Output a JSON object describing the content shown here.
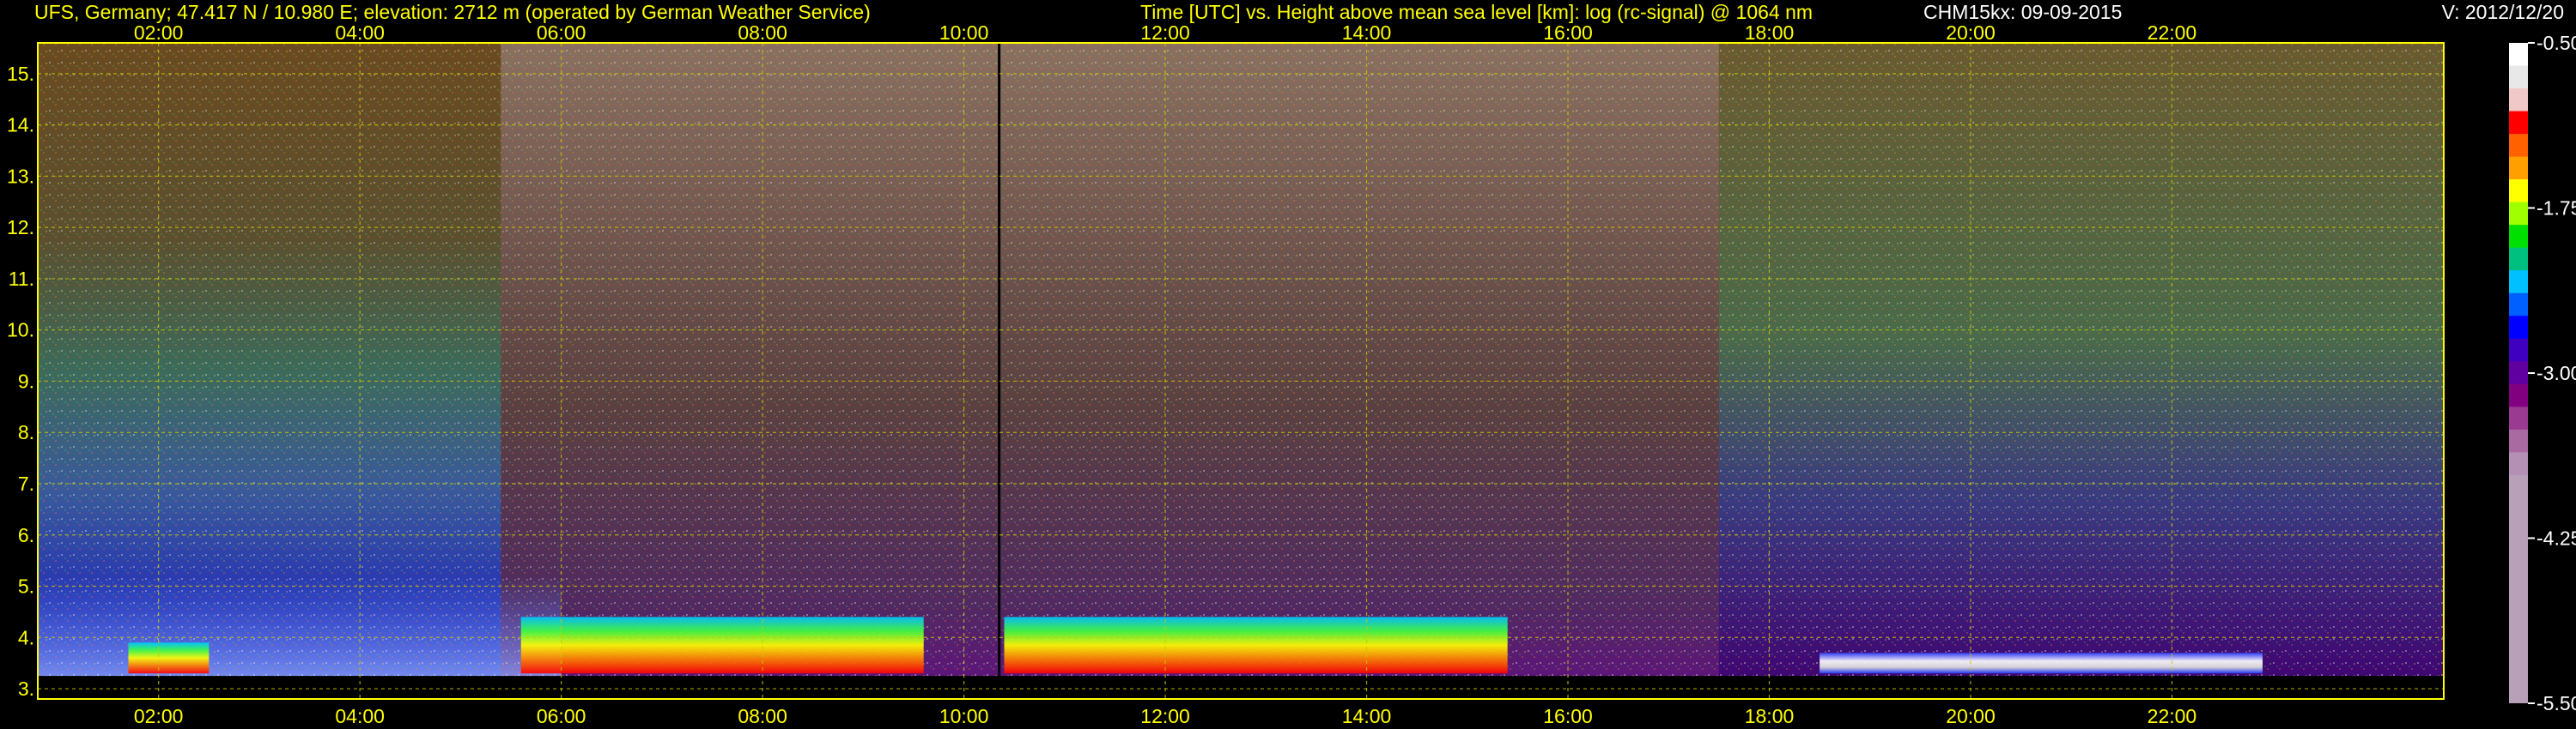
{
  "header": {
    "station": "UFS, Germany; 47.417 N / 10.980 E; elevation: 2712 m  (operated by German Weather Service)",
    "axes_title": "Time [UTC] vs. Height above mean sea level [km]: log (rc-signal) @ 1064 nm",
    "instrument_date": "CHM15kx: 09-09-2015",
    "version": "V: 2012/12/20"
  },
  "colors": {
    "axis": "#ffff00",
    "grid": "#c8c800",
    "text_white": "#ffffff",
    "background": "#000000"
  },
  "chart_data": {
    "type": "heatmap",
    "x_label": "Time [UTC]",
    "y_label": "Height above mean sea level [km]",
    "x_range_hours": [
      0.8,
      24.7
    ],
    "y_range_km": [
      2.8,
      15.6
    ],
    "x_ticks": [
      "02:00",
      "04:00",
      "06:00",
      "08:00",
      "10:00",
      "12:00",
      "14:00",
      "16:00",
      "18:00",
      "20:00",
      "22:00"
    ],
    "x_tick_hours": [
      2,
      4,
      6,
      8,
      10,
      12,
      14,
      16,
      18,
      20,
      22
    ],
    "y_ticks": [
      "3.",
      "4.",
      "5.",
      "6.",
      "7.",
      "8.",
      "9.",
      "10.",
      "11.",
      "12.",
      "13.",
      "14.",
      "15."
    ],
    "y_tick_values": [
      3,
      4,
      5,
      6,
      7,
      8,
      9,
      10,
      11,
      12,
      13,
      14,
      15
    ],
    "grid": true,
    "colorbar": {
      "labels": [
        "-0.50",
        "-1.75",
        "-3.00",
        "-4.25",
        "-5.50"
      ],
      "values": [
        -0.5,
        -1.75,
        -3.0,
        -4.25,
        -5.5
      ],
      "colors": [
        "#ffffff",
        "#e8e8e8",
        "#f0c8c8",
        "#ff0000",
        "#ff6000",
        "#ffa000",
        "#ffff00",
        "#a0ff00",
        "#00e000",
        "#00c080",
        "#00c0ff",
        "#0060ff",
        "#0000ff",
        "#4000c0",
        "#6000a0",
        "#800080",
        "#9a3a90",
        "#a86aa0",
        "#b490b4",
        "#b8a0b8"
      ]
    },
    "cloud_layers": [
      {
        "start_h": 1.7,
        "end_h": 2.5,
        "base_km": 3.3,
        "top_km": 3.9
      },
      {
        "start_h": 5.6,
        "end_h": 9.6,
        "base_km": 3.3,
        "top_km": 4.4
      },
      {
        "start_h": 10.4,
        "end_h": 15.4,
        "base_km": 3.3,
        "top_km": 4.4
      },
      {
        "start_h": 18.5,
        "end_h": 22.9,
        "base_km": 3.3,
        "top_km": 3.7
      }
    ]
  }
}
